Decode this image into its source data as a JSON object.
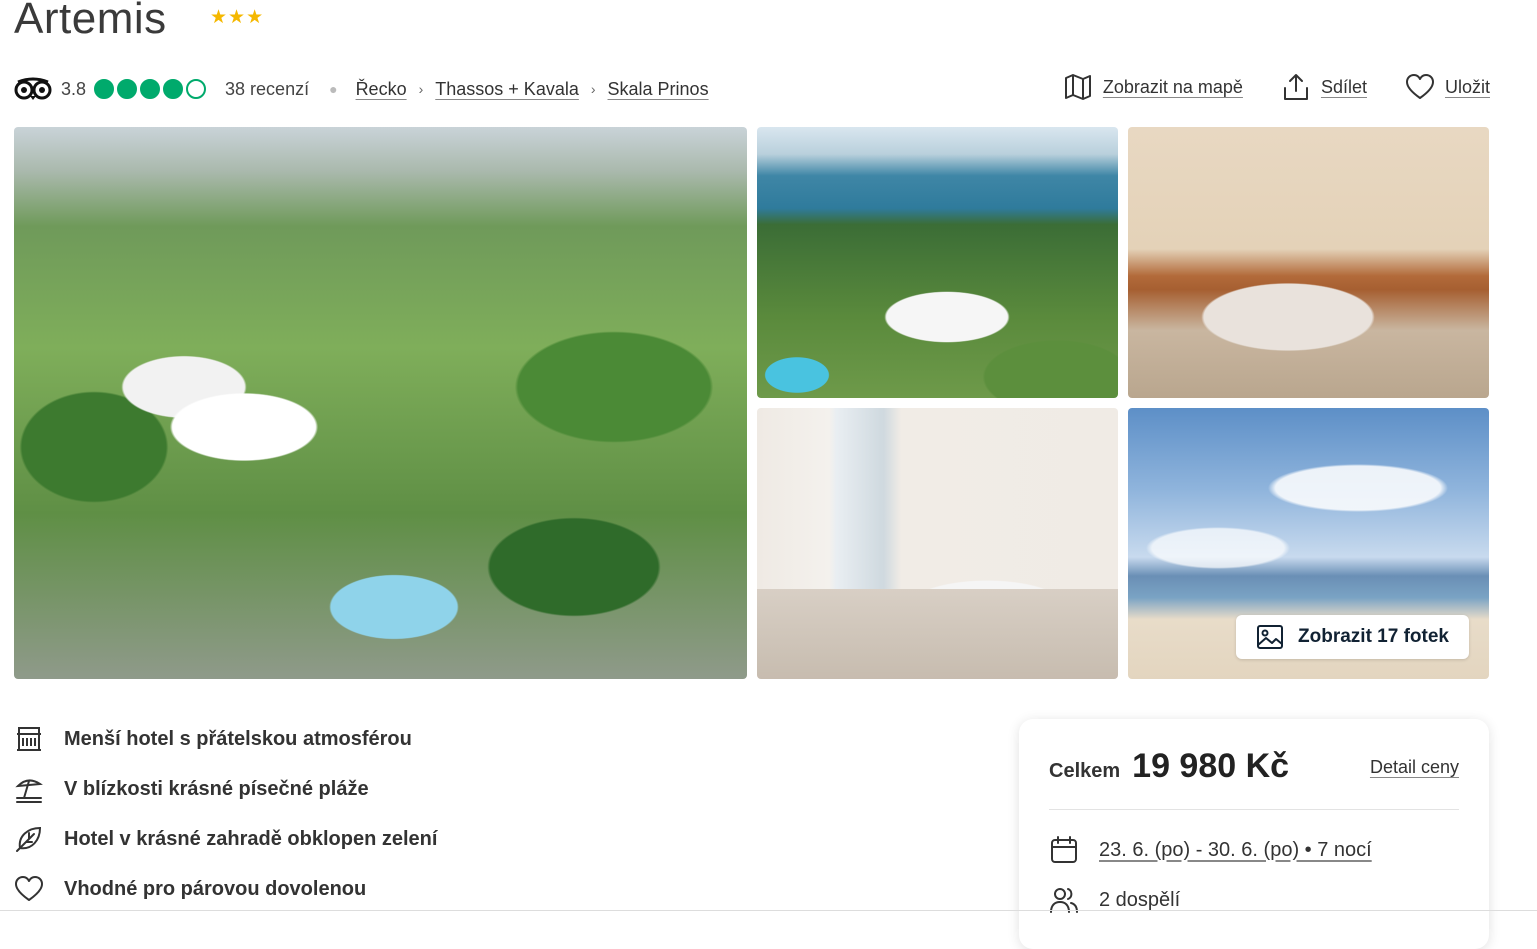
{
  "hotel": {
    "name": "Artemis",
    "star_count": 3
  },
  "rating": {
    "score": "3.8",
    "filled_bubbles": 4,
    "total_bubbles": 5,
    "reviews": "38 recenzí"
  },
  "breadcrumb": [
    "Řecko",
    "Thassos + Kavala",
    "Skala Prinos"
  ],
  "actions": {
    "map": "Zobrazit na mapě",
    "share": "Sdílet",
    "save": "Uložit"
  },
  "gallery": {
    "show_photos": "Zobrazit 17 fotek"
  },
  "features": [
    {
      "icon": "hotel-icon",
      "text": "Menší hotel s přátelskou atmosférou"
    },
    {
      "icon": "beach-umbrella-icon",
      "text": "V blízkosti krásné písečné pláže"
    },
    {
      "icon": "leaf-icon",
      "text": "Hotel v krásné zahradě obklopen zelení"
    },
    {
      "icon": "heart-icon",
      "text": "Vhodné pro párovou dovolenou"
    }
  ],
  "price": {
    "label": "Celkem",
    "amount": "19 980 Kč",
    "detail": "Detail ceny",
    "dates": "23. 6. (po) - 30. 6. (po) • 7 nocí",
    "guests": "2 dospělí"
  },
  "colors": {
    "rating_green": "#00aa6c",
    "star_gold": "#f5b800",
    "text_dark": "#2b2b2b"
  }
}
